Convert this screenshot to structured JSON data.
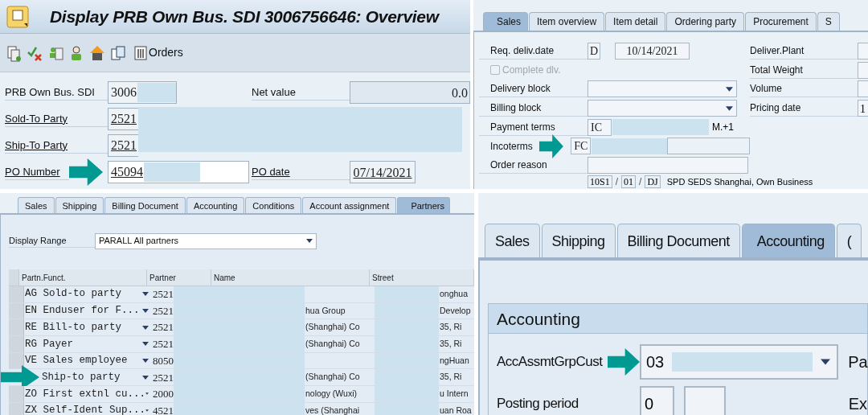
{
  "overview": {
    "title": "Display PRB Own Bus. SDI 3006756646: Overview",
    "toolbar_label": "Orders",
    "fields": [
      {
        "label": "PRB Own Bus. SDI",
        "value": "3006",
        "link": false,
        "arrow": false
      },
      {
        "label": "Sold-To Party",
        "value": "2521",
        "link": true,
        "arrow": false
      },
      {
        "label": "Ship-To Party",
        "value": "2521",
        "link": true,
        "arrow": false
      },
      {
        "label": "PO Number",
        "value": "45094",
        "link": true,
        "arrow": true
      }
    ],
    "net_value": {
      "label": "Net value",
      "value": "0.0"
    },
    "po_date": {
      "label": "PO date",
      "value": "07/14/2021"
    }
  },
  "header_detail": {
    "tabs": [
      {
        "label": "Sales",
        "selected": true
      },
      {
        "label": "Item overview",
        "selected": false
      },
      {
        "label": "Item detail",
        "selected": false
      },
      {
        "label": "Ordering party",
        "selected": false
      },
      {
        "label": "Procurement",
        "selected": false
      },
      {
        "label": "S",
        "selected": false
      }
    ],
    "left_fields": [
      {
        "kind": "date",
        "label": "Req. deliv.date",
        "unit": "D",
        "value": "10/14/2021",
        "arrow": false
      },
      {
        "kind": "checkbox",
        "label": "Complete dlv.",
        "checked": false,
        "disabled": true
      },
      {
        "kind": "dropdown",
        "label": "Delivery block",
        "arrow": false
      },
      {
        "kind": "dropdown",
        "label": "Billing block",
        "arrow": false
      },
      {
        "kind": "text",
        "label": "Payment terms",
        "value": "IC",
        "description": "M.+1",
        "arrow": false
      },
      {
        "kind": "text",
        "label": "Incoterms",
        "value": "FC",
        "arrow": true
      },
      {
        "kind": "wide",
        "label": "Order reason",
        "arrow": false
      }
    ],
    "right_fields": [
      {
        "label": "Deliver.Plant"
      },
      {
        "label": "Total Weight"
      },
      {
        "label": "Volume"
      },
      {
        "label": "Pricing date",
        "value": "1"
      }
    ],
    "sales_area": {
      "values": [
        "10S1",
        "01",
        "DJ"
      ],
      "separator": "/",
      "description": "SPD SEDS Shanghai, Own Business"
    }
  },
  "partners": {
    "tabs": [
      {
        "label": "Sales",
        "selected": false
      },
      {
        "label": "Shipping",
        "selected": false
      },
      {
        "label": "Billing Document",
        "selected": false
      },
      {
        "label": "Accounting",
        "selected": false
      },
      {
        "label": "Conditions",
        "selected": false
      },
      {
        "label": "Account assignment",
        "selected": false
      },
      {
        "label": "Partners",
        "selected": true
      }
    ],
    "display_range": {
      "label": "Display Range",
      "value": "PARALL All partners"
    },
    "columns": [
      "Partn.Funct.",
      "Partner",
      "Name",
      "Street"
    ],
    "rows": [
      {
        "function": "AG Sold-to party",
        "partner": "2521",
        "name": "",
        "street": "onghua",
        "arrow": false
      },
      {
        "function": "EN Enduser for F...",
        "partner": "2521",
        "name": "hua Group",
        "street": "Develop",
        "arrow": false
      },
      {
        "function": "RE Bill-to party",
        "partner": "2521",
        "name": "(Shanghai) Co",
        "street": "35, Ri",
        "arrow": false
      },
      {
        "function": "RG Payer",
        "partner": "2521",
        "name": "(Shanghai) Co",
        "street": "35, Ri",
        "arrow": false
      },
      {
        "function": "VE Sales employee",
        "partner": "8050",
        "name": "",
        "street": "ngHuan",
        "arrow": false
      },
      {
        "function": "Ship-to party",
        "partner": "2521",
        "name": "(Shanghai) Co",
        "street": "35, Ri",
        "arrow": true
      },
      {
        "function": "ZO First extnl cu...",
        "partner": "2000",
        "name": "nology (Wuxi)",
        "street": "u Intern",
        "arrow": false
      },
      {
        "function": "ZX Self-Ident Sup...",
        "partner": "4521",
        "name": "ves (Shanghai",
        "street": "uan Roa",
        "arrow": false
      }
    ]
  },
  "accounting": {
    "tabs": [
      {
        "label": "Sales",
        "selected": false
      },
      {
        "label": "Shipping",
        "selected": false
      },
      {
        "label": "Billing Document",
        "selected": false
      },
      {
        "label": "Accounting",
        "selected": true
      },
      {
        "label": "(",
        "selected": false
      }
    ],
    "group_title": "Accounting",
    "rows": [
      {
        "label": "AccAssmtGrpCust",
        "value": "03",
        "kind": "dropdown",
        "right_label": "Pa",
        "arrow": true
      },
      {
        "label": "Posting period",
        "value": "0",
        "kind": "pair",
        "right_label": "Ex",
        "arrow": false
      }
    ]
  }
}
